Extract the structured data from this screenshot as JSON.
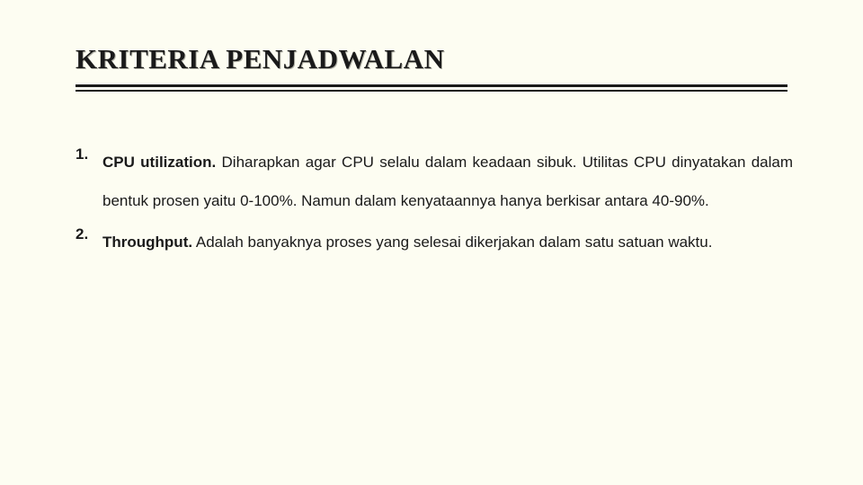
{
  "slide": {
    "title": "KRITERIA PENJADWALAN",
    "background_color": "#fdfdf2",
    "text_color": "#1a1a1a",
    "items": [
      {
        "number": "1.",
        "lead": "CPU utilization.",
        "text": "Diharapkan agar CPU selalu dalam keadaan sibuk. Utilitas CPU dinyatakan dalam bentuk prosen yaitu 0-100%. Namun dalam kenyataannya hanya berkisar antara 40-90%."
      },
      {
        "number": "2.",
        "lead": "Throughput.",
        "text": "Adalah banyaknya proses yang selesai dikerjakan dalam satu satuan waktu."
      }
    ]
  }
}
